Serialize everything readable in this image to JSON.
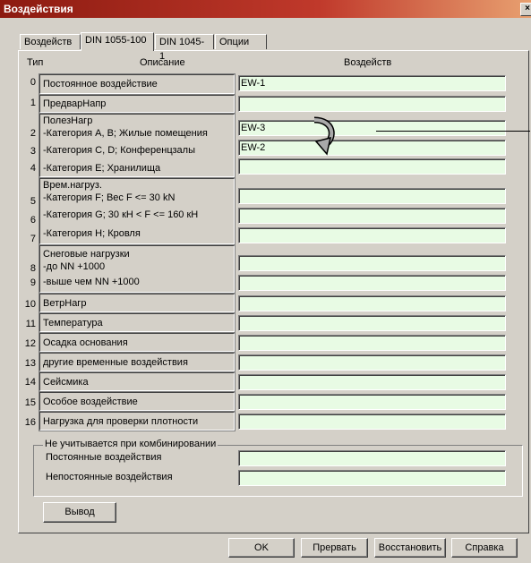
{
  "window": {
    "title": "Воздействия",
    "close_glyph": "×"
  },
  "tabs": [
    "Воздейств",
    "DIN 1055-100",
    "DIN 1045-1",
    "Опции"
  ],
  "headers": {
    "type": "Тип",
    "description": "Описание",
    "effect": "Воздейств"
  },
  "rows": [
    {
      "num": "0",
      "lines": [
        "Постоянное воздействие"
      ],
      "fields": [
        "EW-1"
      ]
    },
    {
      "num": "1",
      "lines": [
        "ПредварНапр"
      ],
      "fields": [
        ""
      ]
    },
    {
      "num": "2",
      "num2": "3",
      "num3": "4",
      "lines": [
        "ПолезНагр",
        "-Категория A, B; Жилые помещения",
        "-Категория C, D; Конференцзалы",
        "-Категория E; Хранилища"
      ],
      "fields": [
        "EW-3",
        "EW-2",
        ""
      ]
    },
    {
      "num": "5",
      "num2": "6",
      "num3": "7",
      "lines": [
        "Врем.нагруз.",
        "-Категория F; Вес F <= 30 kN",
        "-Категория G; 30 кН < F <= 160 кН",
        "-Категория H; Кровля"
      ],
      "fields": [
        "",
        "",
        ""
      ]
    },
    {
      "num": "8",
      "num2": "9",
      "lines": [
        "Снеговые нагрузки",
        "-до NN +1000",
        "-выше чем NN +1000"
      ],
      "fields": [
        "",
        ""
      ]
    },
    {
      "num": "10",
      "lines": [
        "ВетрНагр"
      ],
      "fields": [
        ""
      ]
    },
    {
      "num": "11",
      "lines": [
        "Температура"
      ],
      "fields": [
        ""
      ]
    },
    {
      "num": "12",
      "lines": [
        "Осадка основания"
      ],
      "fields": [
        ""
      ]
    },
    {
      "num": "13",
      "lines": [
        "другие временные воздействия"
      ],
      "fields": [
        ""
      ]
    },
    {
      "num": "14",
      "lines": [
        "Сейсмика"
      ],
      "fields": [
        ""
      ]
    },
    {
      "num": "15",
      "lines": [
        "Особое воздействие"
      ],
      "fields": [
        ""
      ]
    },
    {
      "num": "16",
      "lines": [
        "Нагрузка для проверки плотности"
      ],
      "fields": [
        ""
      ]
    }
  ],
  "group": {
    "title": "Не учитывается при комбинировании",
    "permanent_label": "Постоянные воздействия",
    "variable_label": "Непостоянные воздействия",
    "permanent_value": "",
    "variable_value": ""
  },
  "buttons": {
    "output": "Вывод",
    "ok": "OK",
    "abort": "Прервать",
    "restore": "Восстановить",
    "help": "Справка"
  },
  "colors": {
    "field_bg": "#e8fbe4",
    "title_start": "#8c1a10",
    "face": "#d4d0c8"
  }
}
